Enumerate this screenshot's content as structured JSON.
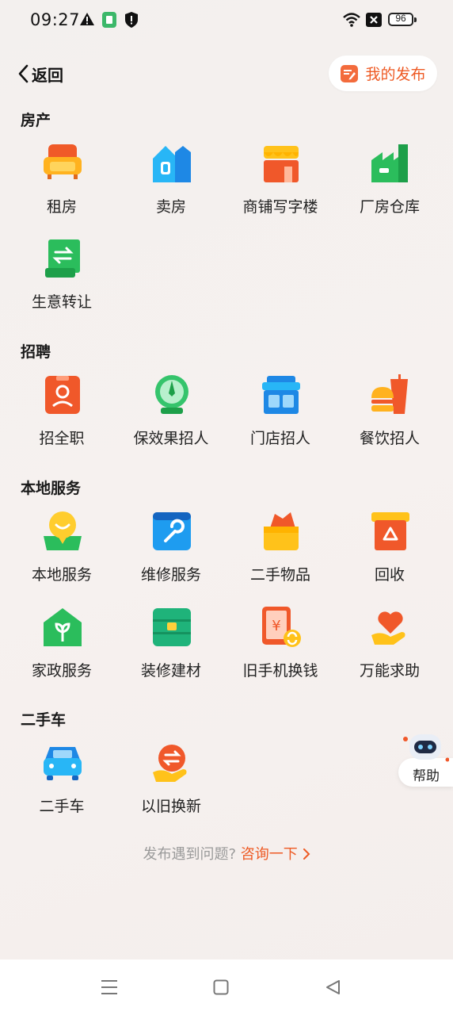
{
  "status_bar": {
    "time": "09:27",
    "battery": "96"
  },
  "header": {
    "back_label": "返回",
    "my_post_label": "我的发布"
  },
  "sections": [
    {
      "title": "房产",
      "items": [
        {
          "label": "租房",
          "icon": "sofa-icon"
        },
        {
          "label": "卖房",
          "icon": "house-icon"
        },
        {
          "label": "商铺写字楼",
          "icon": "shop-icon"
        },
        {
          "label": "厂房仓库",
          "icon": "factory-icon"
        },
        {
          "label": "生意转让",
          "icon": "scroll-transfer-icon"
        }
      ]
    },
    {
      "title": "招聘",
      "items": [
        {
          "label": "招全职",
          "icon": "badge-person-icon"
        },
        {
          "label": "保效果招人",
          "icon": "compass-icon"
        },
        {
          "label": "门店招人",
          "icon": "store-icon"
        },
        {
          "label": "餐饮招人",
          "icon": "burger-drink-icon"
        }
      ]
    },
    {
      "title": "本地服务",
      "items": [
        {
          "label": "本地服务",
          "icon": "location-smile-icon"
        },
        {
          "label": "维修服务",
          "icon": "toolbox-wrench-icon"
        },
        {
          "label": "二手物品",
          "icon": "gift-box-icon"
        },
        {
          "label": "回收",
          "icon": "recycle-box-icon"
        },
        {
          "label": "家政服务",
          "icon": "home-sprout-icon"
        },
        {
          "label": "装修建材",
          "icon": "cabinet-icon"
        },
        {
          "label": "旧手机换钱",
          "icon": "phone-yuan-icon"
        },
        {
          "label": "万能求助",
          "icon": "heart-hand-icon"
        }
      ]
    },
    {
      "title": "二手车",
      "items": [
        {
          "label": "二手车",
          "icon": "car-icon"
        },
        {
          "label": "以旧换新",
          "icon": "exchange-hand-icon"
        }
      ]
    }
  ],
  "help": {
    "label": "帮助",
    "icon": "robot-icon"
  },
  "footer": {
    "question": "发布遇到问题?",
    "link": "咨询一下"
  }
}
